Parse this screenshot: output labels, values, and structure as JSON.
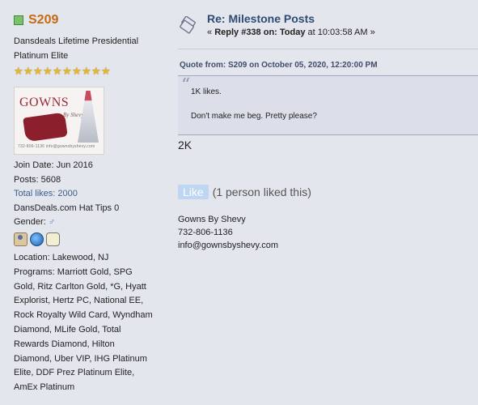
{
  "poster": {
    "username": "S209",
    "rank_line1": "Dansdeals Lifetime Presidential",
    "rank_line2": "Platinum Elite",
    "star_count": 10,
    "avatar": {
      "title": "GOWNS",
      "subtitle": "By Shevy",
      "footer": "732-806-1136 info@gownsbyshevy.com"
    },
    "join_date": "Join Date: Jun 2016",
    "posts": "Posts: 5608",
    "total_likes": "Total likes: 2000",
    "hat_tips": "DansDeals.com Hat Tips 0",
    "gender_label": "Gender:",
    "gender_symbol": "♂",
    "location_lines": [
      "Location: Lakewood, NJ",
      "Programs: Marriott Gold, SPG",
      "Gold, Ritz Carlton Gold, *G, Hyatt",
      "Explorist, Hertz PC, National EE,",
      "Rock Royalty Wild Card, Wyndham",
      "Diamond, MLife Gold, Total",
      "Rewards Diamond, Hilton",
      "Diamond, Uber VIP, IHG Platinum",
      "Elite, DDF Prez Platinum Elite,",
      "AmEx Platinum"
    ],
    "online_color": "#7ac36a",
    "username_color": "#c96a12"
  },
  "post": {
    "title": "Re: Milestone Posts",
    "reply_prefix": "« ",
    "reply_label": "Reply #338 on:",
    "reply_day": "Today",
    "reply_time": " at 10:03:58 AM »",
    "quote_header": "Quote from: S209 on October 05, 2020, 12:20:00 PM",
    "quote_line1": "1K likes.",
    "quote_line2": "Don't make me beg. Pretty please?",
    "body": "2K",
    "like_button": "Like",
    "like_count": "(1 person liked this)",
    "signature": [
      "Gowns By Shevy",
      "732-806-1136",
      "info@gownsbyshevy.com"
    ],
    "title_color": "#2f4a73"
  }
}
